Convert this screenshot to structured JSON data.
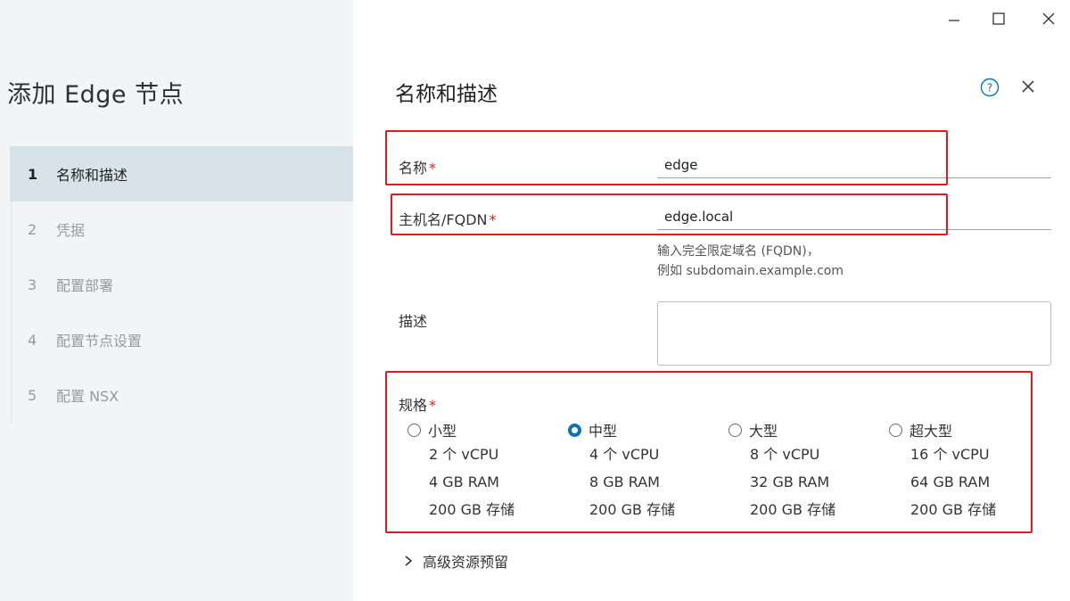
{
  "window": {
    "minimize_icon": "minimize-icon",
    "maximize_icon": "maximize-icon",
    "close_icon": "close-icon"
  },
  "wizard": {
    "title": "添加 Edge 节点",
    "steps": [
      {
        "num": "1",
        "label": "名称和描述",
        "active": true
      },
      {
        "num": "2",
        "label": "凭据",
        "active": false
      },
      {
        "num": "3",
        "label": "配置部署",
        "active": false
      },
      {
        "num": "4",
        "label": "配置节点设置",
        "active": false
      },
      {
        "num": "5",
        "label": "配置 NSX",
        "active": false
      }
    ]
  },
  "pane": {
    "title": "名称和描述",
    "help_icon": "help-circle-icon",
    "close_icon": "close-icon"
  },
  "form": {
    "name": {
      "label": "名称",
      "required": "*",
      "value": "edge"
    },
    "hostname": {
      "label": "主机名/FQDN",
      "required": "*",
      "value": "edge.local",
      "hint_line1": "输入完全限定域名 (FQDN)，",
      "hint_line2": "例如 subdomain.example.com"
    },
    "description": {
      "label": "描述",
      "value": ""
    },
    "form_factor": {
      "label": "规格",
      "required": "*",
      "options": [
        {
          "name": "小型",
          "cpu": "2 个 vCPU",
          "ram": "4 GB RAM",
          "storage": "200 GB 存储",
          "selected": false
        },
        {
          "name": "中型",
          "cpu": "4 个 vCPU",
          "ram": "8 GB RAM",
          "storage": "200 GB 存储",
          "selected": true
        },
        {
          "name": "大型",
          "cpu": "8 个 vCPU",
          "ram": "32 GB RAM",
          "storage": "200 GB 存储",
          "selected": false
        },
        {
          "name": "超大型",
          "cpu": "16 个 vCPU",
          "ram": "64 GB RAM",
          "storage": "200 GB 存储",
          "selected": false
        }
      ]
    },
    "advanced": {
      "label": "高级资源预留",
      "icon": "chevron-right-icon"
    }
  },
  "colors": {
    "accent": "#0a72b8",
    "highlight": "#dd1d1d",
    "required": "#e02020",
    "sidebar_bg": "#f2f4f5",
    "active_step_bg": "#d8e2e9"
  }
}
